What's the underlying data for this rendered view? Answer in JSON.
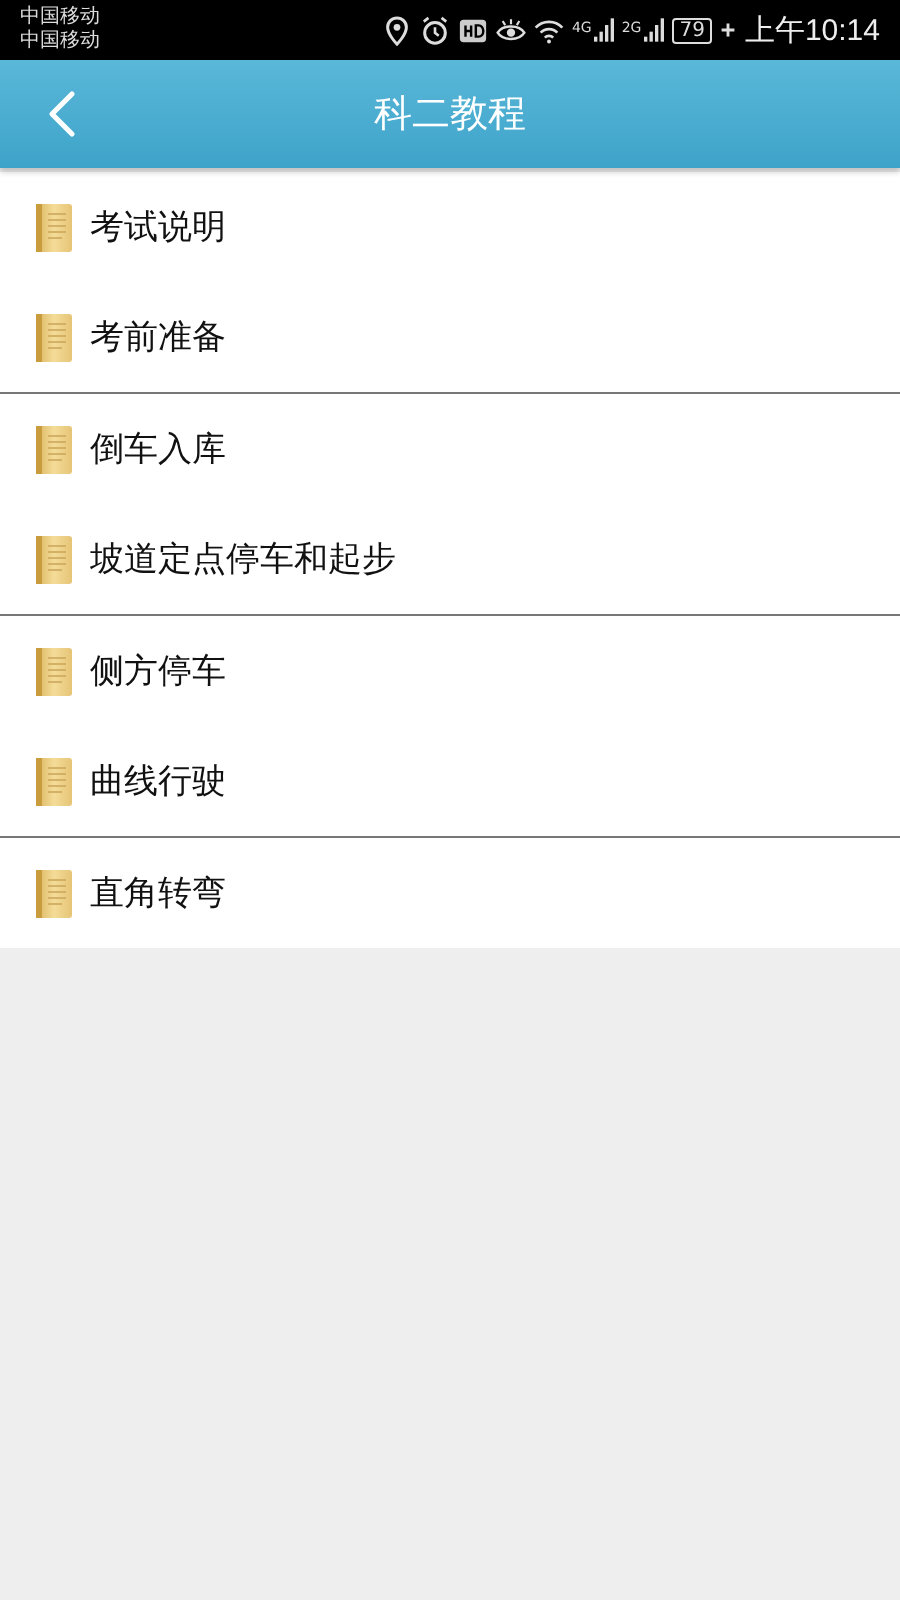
{
  "status_bar": {
    "carriers": [
      "中国移动",
      "中国移动"
    ],
    "network_1": "4G",
    "network_2": "2G",
    "battery": "79",
    "time": "上午10:14"
  },
  "title_bar": {
    "title": "科二教程"
  },
  "sections": [
    {
      "items": [
        {
          "label": "考试说明"
        },
        {
          "label": "考前准备"
        }
      ]
    },
    {
      "items": [
        {
          "label": "倒车入库"
        },
        {
          "label": "坡道定点停车和起步"
        }
      ]
    },
    {
      "items": [
        {
          "label": "侧方停车"
        },
        {
          "label": "曲线行驶"
        }
      ]
    },
    {
      "items": [
        {
          "label": "直角转弯"
        }
      ]
    }
  ]
}
